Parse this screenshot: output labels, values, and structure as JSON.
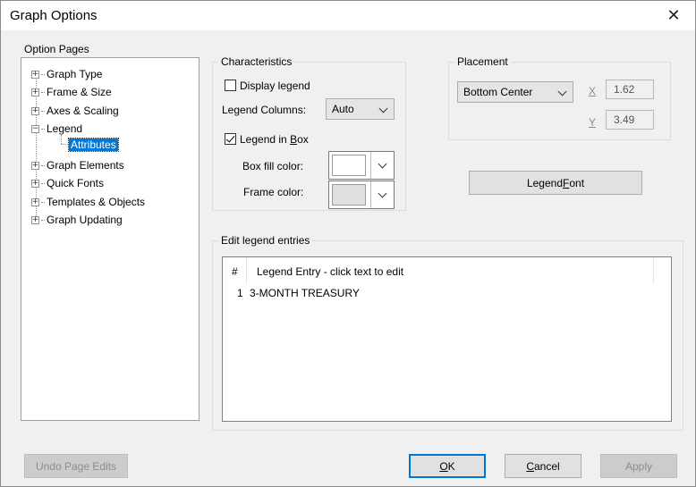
{
  "window": {
    "title": "Graph Options",
    "close_glyph": "✕"
  },
  "option_pages": {
    "label": "Option Pages",
    "items": [
      {
        "label": "Graph Type",
        "expander": "+"
      },
      {
        "label": "Frame & Size",
        "expander": "+"
      },
      {
        "label": "Axes & Scaling",
        "expander": "+"
      },
      {
        "label": "Legend",
        "expander": "−"
      },
      {
        "label": "Attributes",
        "selected": true
      },
      {
        "label": "Graph Elements",
        "expander": "+"
      },
      {
        "label": "Quick Fonts",
        "expander": "+"
      },
      {
        "label": "Templates & Objects",
        "expander": "+"
      },
      {
        "label": "Graph Updating",
        "expander": "+"
      }
    ]
  },
  "characteristics": {
    "title": "Characteristics",
    "display_legend": {
      "label": "Display legend",
      "checked": false
    },
    "legend_columns": {
      "label": "Legend Columns:",
      "value": "Auto"
    },
    "legend_in_box": {
      "label_pre": "Legend in ",
      "label_ul": "B",
      "label_post": "ox",
      "checked": true
    },
    "box_fill_color": {
      "label": "Box fill color:",
      "color": "#ffffff"
    },
    "frame_color": {
      "label": "Frame color:",
      "color": "#e0e0e0"
    }
  },
  "placement": {
    "title": "Placement",
    "position": "Bottom Center",
    "x_label": "X",
    "x_value": "1.62",
    "y_label": "Y",
    "y_value": "3.49"
  },
  "legend_font_button": {
    "label_pre": "Legend ",
    "label_ul": "F",
    "label_post": "ont"
  },
  "edit_entries": {
    "title": "Edit legend entries",
    "columns": [
      "#",
      "Legend Entry -  click text to edit"
    ],
    "rows": [
      {
        "num": "1",
        "entry": "3-MONTH TREASURY"
      }
    ]
  },
  "buttons": {
    "undo": "Undo Page Edits",
    "ok_ul": "O",
    "ok_post": "K",
    "cancel_ul": "C",
    "cancel_post": "ancel",
    "apply": "Apply"
  },
  "colors": {
    "selection": "#0078d7",
    "default_button_border": "#0078d7"
  }
}
